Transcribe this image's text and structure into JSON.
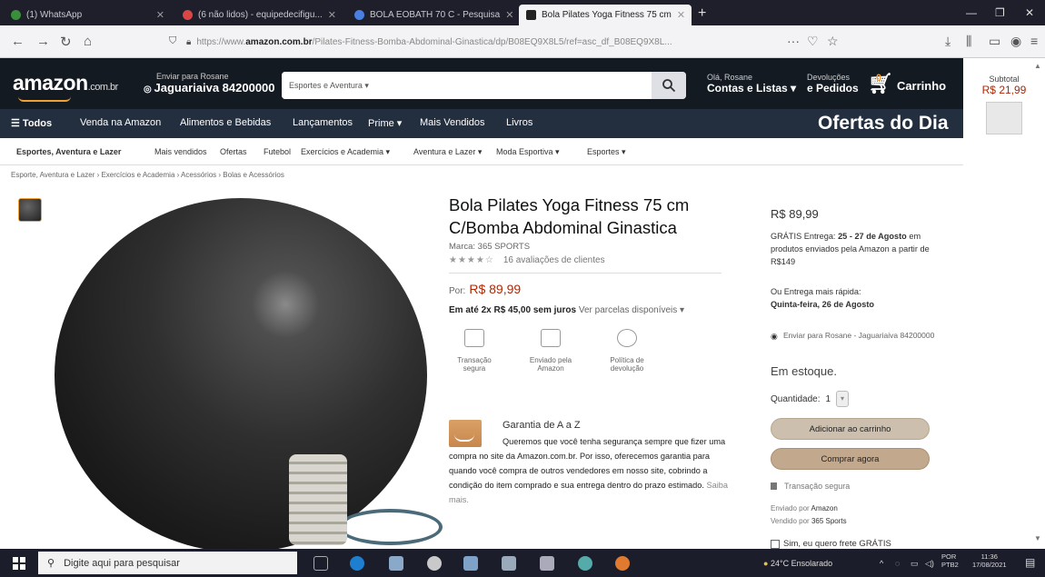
{
  "browser": {
    "tabs": [
      {
        "label": "(1) WhatsApp"
      },
      {
        "label": "(6 não lidos) - equipedecifigu..."
      },
      {
        "label": "BOLA EOBATH 70 C - Pesquisa"
      },
      {
        "label": "Bola Pilates Yoga Fitness 75 cm"
      }
    ],
    "url_prefix": "https://www.",
    "url_domain": "amazon.com.br",
    "url_rest": "/Pilates-Fitness-Bomba-Abdominal-Ginastica/dp/B08EQ9X8L5/ref=asc_df_B08EQ9X8L..."
  },
  "header": {
    "logo": "amazon",
    "logo_suffix": ".com.br",
    "deliver_line1": "Enviar para Rosane",
    "deliver_line2": "Jaguariaiva 84200000",
    "search_category": "Esportes e Aventura ▾",
    "account_small": "Olá, Rosane",
    "account_big": "Contas e Listas ▾",
    "returns_small": "Devoluções",
    "returns_big": "e Pedidos",
    "cart_count": "0",
    "cart_label": "Carrinho"
  },
  "subtotal": {
    "label": "Subtotal",
    "value": "R$ 21,99"
  },
  "nav": {
    "all": "Todos",
    "items": [
      "Venda na Amazon",
      "Alimentos e Bebidas",
      "Lançamentos",
      "Prime ▾",
      "Mais Vendidos",
      "Livros"
    ],
    "deals": "Ofertas do Dia"
  },
  "categories": [
    "Esportes, Aventura e Lazer",
    "Mais vendidos",
    "Ofertas",
    "Futebol",
    "Exercícios e Academia ▾",
    "Aventura e Lazer ▾",
    "Moda Esportiva ▾",
    "Esportes ▾"
  ],
  "breadcrumb": "Esporte, Aventura e Lazer › Exercícios e Academia › Acessórios › Bolas e Acessórios",
  "product": {
    "title": "Bola Pilates Yoga Fitness 75 cm C/Bomba Abdominal Ginastica",
    "brand": "Marca: 365 SPORTS",
    "stars": "★★★★☆",
    "rating_count": "16 avaliações de clientes",
    "price_label": "Por:",
    "price": "R$ 89,99",
    "installments_bold": "Em até 2x R$ 45,00 sem juros",
    "installments_link": "Ver parcelas disponíveis ▾",
    "features": [
      "Transação segura",
      "Enviado pela Amazon",
      "Política de devolução"
    ],
    "guarantee_title": "Garantia de A a Z",
    "guarantee_text": "Queremos que você tenha segurança sempre que fizer uma compra no site da Amazon.com.br. Por isso, oferecemos garantia para quando você compra de outros vendedores em nosso site, cobrindo a condição do item comprado e sua entrega dentro do prazo estimado.",
    "guarantee_link": "Saiba mais."
  },
  "buybox": {
    "price": "R$ 89,99",
    "shipping_pre": "GRÁTIS Entrega:",
    "shipping_date": "25 - 27 de Agosto",
    "shipping_post": "em produtos enviados pela Amazon a partir de R$149",
    "fast_line1": "Ou Entrega mais rápida:",
    "fast_line2": "Quinta-feira, 26 de Agosto",
    "location": "Enviar para Rosane - Jaguariaiva 84200000",
    "stock": "Em estoque.",
    "qty_label": "Quantidade:",
    "qty_value": "1",
    "add_to_cart": "Adicionar ao carrinho",
    "buy_now": "Comprar agora",
    "secure": "Transação segura",
    "shipped_by_label": "Enviado por",
    "shipped_by": "Amazon",
    "sold_by_label": "Vendido por",
    "sold_by": "365 Sports",
    "free_shipping": "Sim, eu quero frete GRÁTIS"
  },
  "taskbar": {
    "search_placeholder": "Digite aqui para pesquisar",
    "weather": "24°C Ensolarado",
    "lang1": "POR",
    "lang2": "PTB2",
    "time": "11:36",
    "date": "17/08/2021"
  }
}
